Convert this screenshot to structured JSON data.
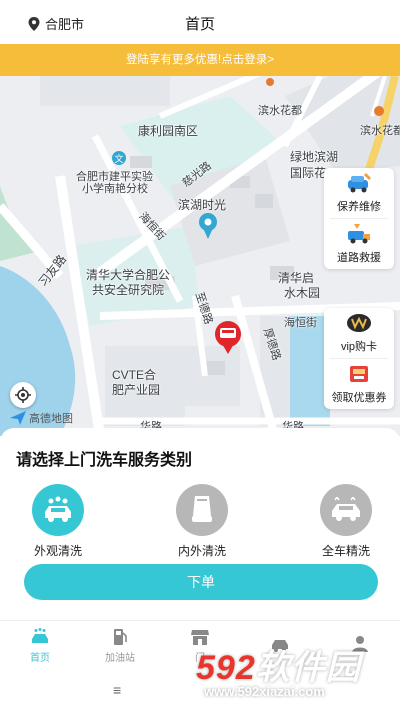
{
  "header": {
    "city": "合肥市",
    "title": "首页"
  },
  "banner": {
    "text": "登陆享有更多优惠!点击登录>"
  },
  "map": {
    "labels": [
      "康利园南区",
      "滨水花都",
      "滨水花都",
      "绿地滨湖",
      "国际花",
      "合肥市建平实验",
      "小学南艳分校",
      "慈光路",
      "滨湖时光",
      "海恒街",
      "习友路",
      "清华大学合肥公",
      "共安全研究院",
      "清华启",
      "水木园",
      "海恒街",
      "至德路",
      "厚德路",
      "CVTE合",
      "肥产业园",
      "华路",
      "华路"
    ],
    "logo": "高德地图"
  },
  "floating": {
    "card1": [
      {
        "icon": "repair-icon",
        "label": "保养维修"
      },
      {
        "icon": "rescue-icon",
        "label": "道路救援"
      }
    ],
    "card2": [
      {
        "icon": "vip-icon",
        "label": "vip购卡"
      },
      {
        "icon": "coupon-icon",
        "label": "领取优惠券"
      }
    ]
  },
  "sheet": {
    "title": "请选择上门洗车服务类别",
    "services": [
      {
        "icon": "exterior-wash-icon",
        "label": "外观清洗",
        "selected": true
      },
      {
        "icon": "interior-wash-icon",
        "label": "内外清洗",
        "selected": false
      },
      {
        "icon": "full-detail-icon",
        "label": "全车精洗",
        "selected": false
      }
    ],
    "order_button": "下单"
  },
  "tabs": [
    {
      "icon": "car-wash-icon",
      "label": "首页",
      "active": true
    },
    {
      "icon": "gas-station-icon",
      "label": "加油站",
      "active": false
    },
    {
      "icon": "shop-icon",
      "label": "门",
      "active": false
    },
    {
      "icon": "car-icon",
      "label": "",
      "active": false
    },
    {
      "icon": "user-icon",
      "label": "",
      "active": false
    }
  ],
  "system": {
    "menu_glyph": "≡"
  },
  "watermark": {
    "brand_num": "592",
    "brand_cn": "软件园",
    "url": "www.592xiazai.com"
  },
  "colors": {
    "accent": "#35c8d4",
    "banner": "#f6bd3a",
    "pin": "#e0262b"
  }
}
